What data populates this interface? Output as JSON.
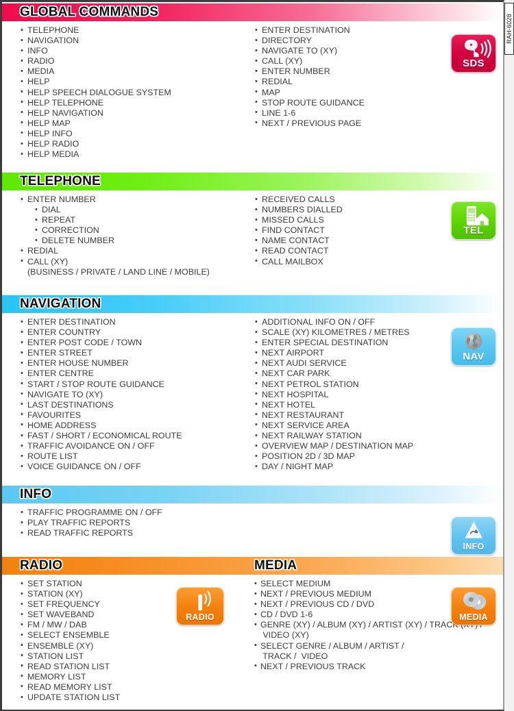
{
  "document": {
    "reference_code": "RAH-6028"
  },
  "sections": [
    {
      "id": "global-commands",
      "title": "GLOBAL COMMANDS",
      "color": "#ee0d4e",
      "badge": {
        "label": "SDS",
        "icon": "speech-dialogue-head-icon"
      },
      "left_column": [
        {
          "text": "TELEPHONE"
        },
        {
          "text": "NAVIGATION"
        },
        {
          "text": "INFO"
        },
        {
          "text": "RADIO"
        },
        {
          "text": "MEDIA"
        },
        {
          "text": "HELP"
        },
        {
          "text": "HELP SPEECH DIALOGUE SYSTEM"
        },
        {
          "text": "HELP TELEPHONE"
        },
        {
          "text": "HELP NAVIGATION"
        },
        {
          "text": "HELP MAP"
        },
        {
          "text": "HELP INFO"
        },
        {
          "text": "HELP RADIO"
        },
        {
          "text": "HELP MEDIA"
        }
      ],
      "right_column": [
        {
          "text": "ENTER DESTINATION"
        },
        {
          "text": "DIRECTORY"
        },
        {
          "text": "NAVIGATE TO (XY)"
        },
        {
          "text": "CALL (XY)"
        },
        {
          "text": "ENTER NUMBER"
        },
        {
          "text": "REDIAL"
        },
        {
          "text": "MAP"
        },
        {
          "text": "STOP ROUTE GUIDANCE"
        },
        {
          "text": "LINE 1-6"
        },
        {
          "text": "NEXT / PREVIOUS PAGE"
        }
      ]
    },
    {
      "id": "telephone",
      "title": "TELEPHONE",
      "color": "#5fe800",
      "badge": {
        "label": "TEL",
        "icon": "mobile-phone-house-icon"
      },
      "left_column": [
        {
          "text": "ENTER NUMBER"
        },
        {
          "text": "DIAL",
          "level": "sub"
        },
        {
          "text": "REPEAT",
          "level": "sub"
        },
        {
          "text": "CORRECTION",
          "level": "sub"
        },
        {
          "text": "DELETE NUMBER",
          "level": "sub"
        },
        {
          "text": "REDIAL"
        },
        {
          "text": "CALL (XY)"
        },
        {
          "text": "(BUSINESS / PRIVATE / LAND LINE / MOBILE)",
          "level": "cont"
        }
      ],
      "right_column": [
        {
          "text": "RECEIVED CALLS"
        },
        {
          "text": "NUMBERS DIALLED"
        },
        {
          "text": "MISSED CALLS"
        },
        {
          "text": "FIND CONTACT"
        },
        {
          "text": "NAME CONTACT"
        },
        {
          "text": "READ CONTACT"
        },
        {
          "text": "CALL MAILBOX"
        }
      ]
    },
    {
      "id": "navigation",
      "title": "NAVIGATION",
      "color": "#29c4f5",
      "badge": {
        "label": "NAV",
        "icon": "globe-icon"
      },
      "left_column": [
        {
          "text": "ENTER DESTINATION"
        },
        {
          "text": "ENTER COUNTRY"
        },
        {
          "text": "ENTER POST CODE / TOWN"
        },
        {
          "text": "ENTER STREET"
        },
        {
          "text": "ENTER HOUSE NUMBER"
        },
        {
          "text": "ENTER CENTRE"
        },
        {
          "text": "START / STOP ROUTE GUIDANCE"
        },
        {
          "text": "NAVIGATE TO (XY)"
        },
        {
          "text": "LAST DESTINATIONS"
        },
        {
          "text": "FAVOURITES"
        },
        {
          "text": "HOME ADDRESS"
        },
        {
          "text": "FAST / SHORT / ECONOMICAL ROUTE"
        },
        {
          "text": "TRAFFIC AVOIDANCE ON / OFF"
        },
        {
          "text": "ROUTE LIST"
        },
        {
          "text": "VOICE GUIDANCE ON / OFF"
        }
      ],
      "right_column": [
        {
          "text": "ADDITIONAL INFO ON / OFF"
        },
        {
          "text": "SCALE (XY) KILOMETRES / METRES"
        },
        {
          "text": "ENTER SPECIAL DESTINATION"
        },
        {
          "text": "NEXT AIRPORT"
        },
        {
          "text": "NEXT AUDI SERVICE"
        },
        {
          "text": "NEXT CAR PARK"
        },
        {
          "text": "NEXT PETROL STATION"
        },
        {
          "text": "NEXT HOSPITAL"
        },
        {
          "text": "NEXT HOTEL"
        },
        {
          "text": "NEXT RESTAURANT"
        },
        {
          "text": "NEXT SERVICE AREA"
        },
        {
          "text": "NEXT RAILWAY STATION"
        },
        {
          "text": "OVERVIEW MAP / DESTINATION MAP"
        },
        {
          "text": "POSITION 2D / 3D MAP"
        },
        {
          "text": "DAY / NIGHT MAP"
        }
      ]
    },
    {
      "id": "info",
      "title": "INFO",
      "color": "#5bc8f2",
      "badge": {
        "label": "INFO",
        "icon": "traffic-warning-triangle-icon"
      },
      "left_column": [
        {
          "text": "TRAFFIC PROGRAMME ON / OFF"
        },
        {
          "text": "PLAY TRAFFIC REPORTS"
        },
        {
          "text": "READ TRAFFIC REPORTS"
        }
      ],
      "right_column": []
    },
    {
      "id": "radio-media",
      "title": "RADIO",
      "title_right": "MEDIA",
      "color": "#f2820f",
      "badge": {
        "label": "RADIO",
        "icon": "radio-antenna-icon"
      },
      "badge_right": {
        "label": "MEDIA",
        "icon": "compact-discs-icon"
      },
      "left_column": [
        {
          "text": "SET STATION"
        },
        {
          "text": "STATION (XY)"
        },
        {
          "text": "SET FREQUENCY"
        },
        {
          "text": "SET WAVEBAND"
        },
        {
          "text": "FM / MW / DAB"
        },
        {
          "text": "SELECT ENSEMBLE"
        },
        {
          "text": "ENSEMBLE (XY)"
        },
        {
          "text": "STATION LIST"
        },
        {
          "text": "READ STATION LIST"
        },
        {
          "text": "MEMORY LIST"
        },
        {
          "text": "READ MEMORY LIST"
        },
        {
          "text": "UPDATE STATION LIST"
        }
      ],
      "right_column": [
        {
          "text": "SELECT MEDIUM"
        },
        {
          "text": "NEXT / PREVIOUS MEDIUM"
        },
        {
          "text": "NEXT / PREVIOUS CD / DVD"
        },
        {
          "text": "CD / DVD 1-6"
        },
        {
          "text": "GENRE (XY) / ALBUM (XY) / ARTIST (XY) / TRACK (XY) /"
        },
        {
          "text": " VIDEO (XY)",
          "level": "cont"
        },
        {
          "text": "SELECT GENRE / ALBUM / ARTIST /"
        },
        {
          "text": " TRACK /  VIDEO",
          "level": "cont"
        },
        {
          "text": "NEXT / PREVIOUS TRACK"
        }
      ]
    }
  ]
}
